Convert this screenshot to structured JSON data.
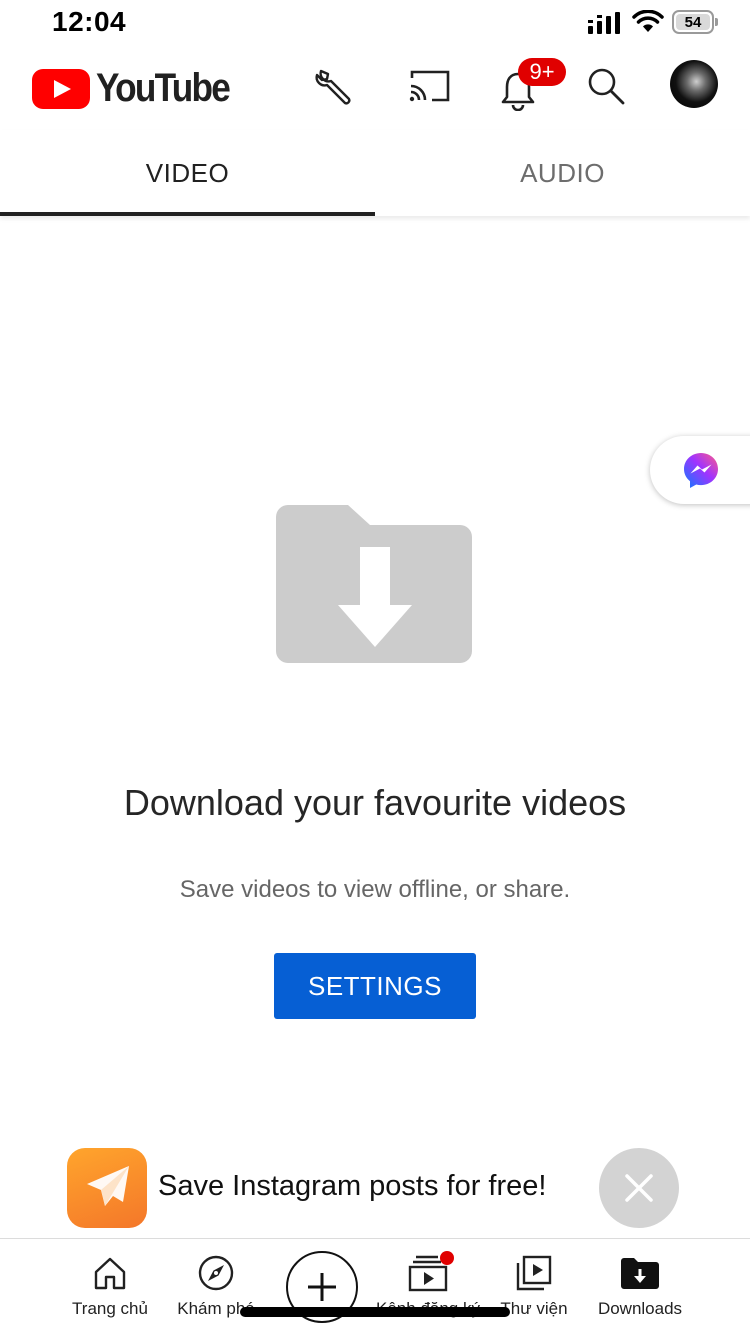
{
  "status_bar": {
    "time": "12:04",
    "battery": "54"
  },
  "header": {
    "logo_text": "YouTube",
    "notification_badge": "9+",
    "icons": [
      "wrench-icon",
      "cast-icon",
      "bell-icon",
      "search-icon",
      "avatar"
    ]
  },
  "tabs": [
    {
      "label": "VIDEO",
      "active": true
    },
    {
      "label": "AUDIO",
      "active": false
    }
  ],
  "empty_state": {
    "title": "Download your favourite videos",
    "subtitle": "Save videos to view offline, or share.",
    "button_label": "SETTINGS"
  },
  "promo": {
    "text": "Save Instagram posts for free!"
  },
  "bottom_nav": {
    "items": [
      {
        "label": "Trang chủ",
        "icon": "home-icon"
      },
      {
        "label": "Khám phá",
        "icon": "compass-icon"
      },
      {
        "label": "",
        "icon": "plus-icon"
      },
      {
        "label": "Kênh đăng ký",
        "icon": "subscriptions-icon"
      },
      {
        "label": "Thư viện",
        "icon": "library-icon"
      },
      {
        "label": "Downloads",
        "icon": "downloads-icon"
      }
    ]
  },
  "colors": {
    "brand_red": "#ff0000",
    "button_blue": "#065fd4",
    "badge_red": "#e00000",
    "promo_orange": "#f4772a"
  }
}
